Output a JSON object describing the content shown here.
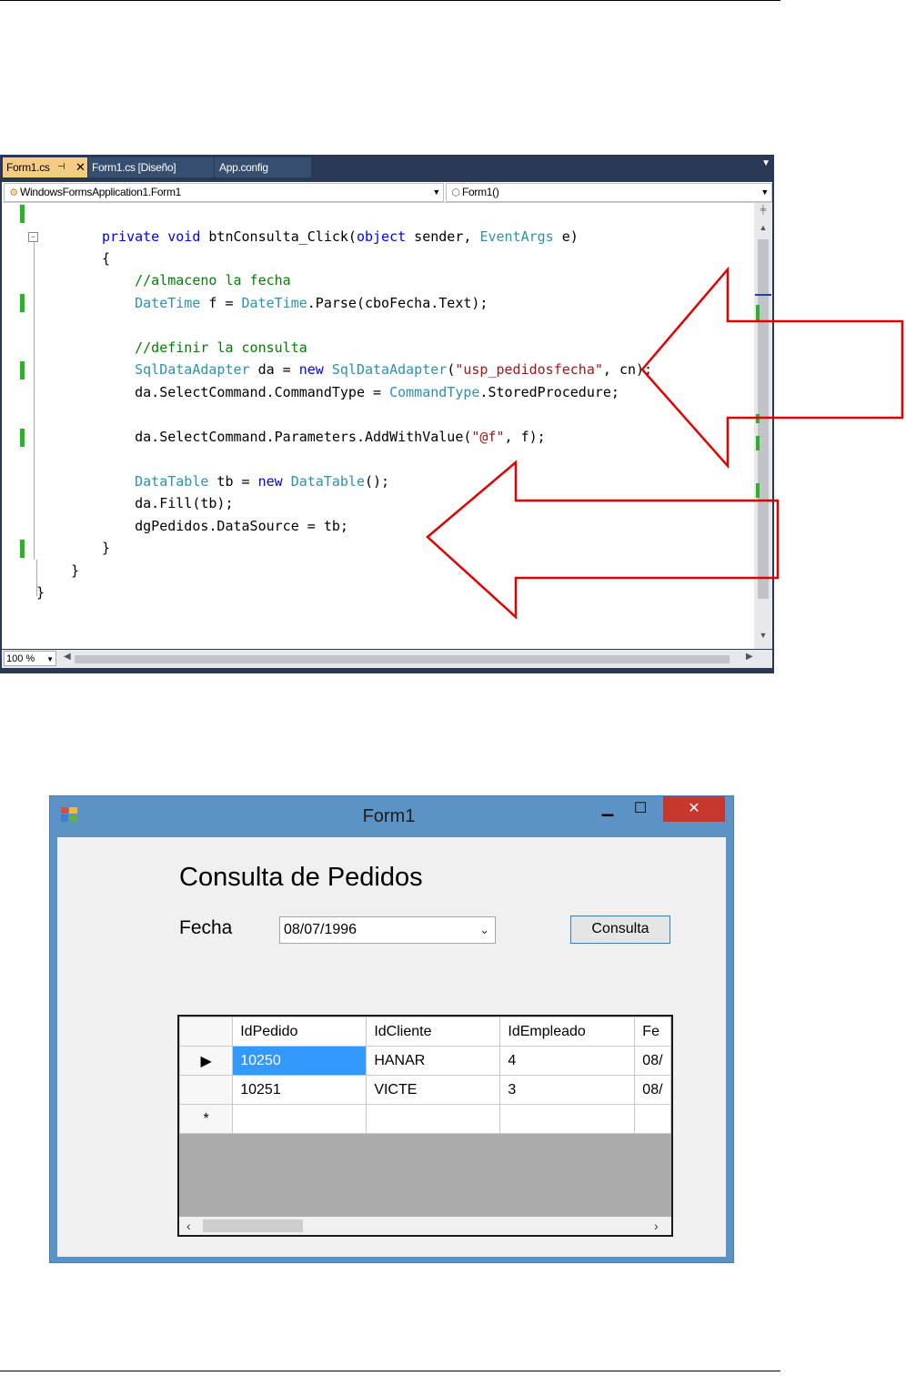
{
  "editor": {
    "tabs": [
      {
        "label": "Form1.cs",
        "active": true
      },
      {
        "label": "Form1.cs [Diseño]",
        "active": false
      },
      {
        "label": "App.config",
        "active": false
      }
    ],
    "nav_class": "WindowsFormsApplication1.Form1",
    "nav_member": "Form1()",
    "zoom": "100 %",
    "code_lines": [
      [
        {
          "c": "kw",
          "t": "private "
        },
        {
          "c": "kw",
          "t": "void "
        },
        {
          "c": "",
          "t": "btnConsulta_Click("
        },
        {
          "c": "kw",
          "t": "object"
        },
        {
          "c": "",
          "t": " sender, "
        },
        {
          "c": "ty",
          "t": "EventArgs"
        },
        {
          "c": "",
          "t": " e)"
        }
      ],
      [
        {
          "c": "",
          "t": "{"
        }
      ],
      [
        {
          "c": "cm",
          "t": "    //almaceno la fecha"
        }
      ],
      [
        {
          "c": "ty",
          "t": "    DateTime"
        },
        {
          "c": "",
          "t": " f = "
        },
        {
          "c": "ty",
          "t": "DateTime"
        },
        {
          "c": "",
          "t": ".Parse(cboFecha.Text);"
        }
      ],
      [
        {
          "c": "",
          "t": ""
        }
      ],
      [
        {
          "c": "cm",
          "t": "    //definir la consulta"
        }
      ],
      [
        {
          "c": "ty",
          "t": "    SqlDataAdapter"
        },
        {
          "c": "",
          "t": " da = "
        },
        {
          "c": "kw",
          "t": "new "
        },
        {
          "c": "ty",
          "t": "SqlDataAdapter"
        },
        {
          "c": "",
          "t": "("
        },
        {
          "c": "st",
          "t": "\"usp_pedidosfecha\""
        },
        {
          "c": "",
          "t": ", cn);"
        }
      ],
      [
        {
          "c": "",
          "t": "    da.SelectCommand.CommandType = "
        },
        {
          "c": "ty",
          "t": "CommandType"
        },
        {
          "c": "",
          "t": ".StoredProcedure;"
        }
      ],
      [
        {
          "c": "",
          "t": ""
        }
      ],
      [
        {
          "c": "",
          "t": "    da.SelectCommand.Parameters.AddWithValue("
        },
        {
          "c": "st",
          "t": "\"@f\""
        },
        {
          "c": "",
          "t": ", f);"
        }
      ],
      [
        {
          "c": "",
          "t": ""
        }
      ],
      [
        {
          "c": "ty",
          "t": "    DataTable"
        },
        {
          "c": "",
          "t": " tb = "
        },
        {
          "c": "kw",
          "t": "new "
        },
        {
          "c": "ty",
          "t": "DataTable"
        },
        {
          "c": "",
          "t": "();"
        }
      ],
      [
        {
          "c": "",
          "t": "    da.Fill(tb);"
        }
      ],
      [
        {
          "c": "",
          "t": "    dgPedidos.DataSource = tb;"
        }
      ],
      [
        {
          "c": "",
          "t": "}"
        }
      ],
      [
        {
          "c": "",
          "t": "}"
        }
      ],
      [
        {
          "c": "",
          "t": "}"
        }
      ]
    ]
  },
  "form": {
    "title": "Form1",
    "heading": "Consulta de Pedidos",
    "fecha_label": "Fecha",
    "fecha_value": "08/07/1996",
    "button_label": "Consulta",
    "grid": {
      "columns": [
        "IdPedido",
        "IdCliente",
        "IdEmpleado",
        "Fe"
      ],
      "rows": [
        [
          "10250",
          "HANAR",
          "4",
          "08/"
        ],
        [
          "10251",
          "VICTE",
          "3",
          "08/"
        ]
      ],
      "new_row_marker": "*",
      "current_row_marker": "▶"
    }
  }
}
